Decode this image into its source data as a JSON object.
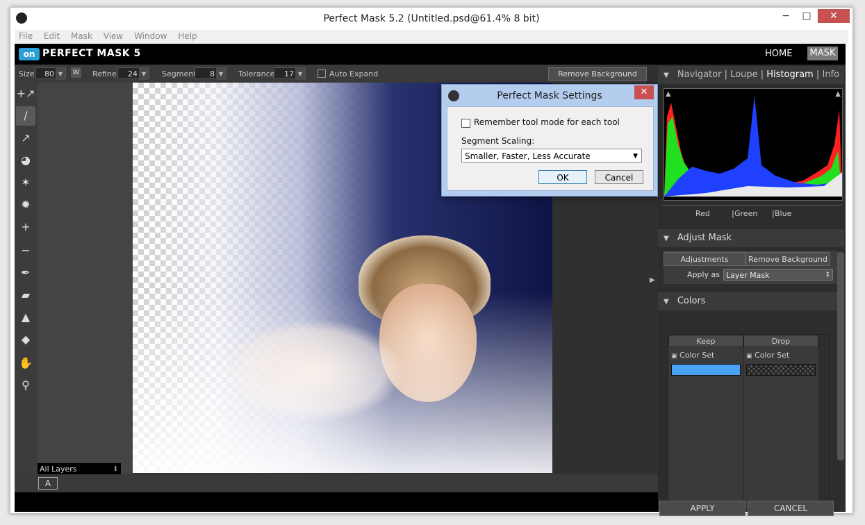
{
  "window": {
    "title": "Perfect Mask 5.2 (Untitled.psd@61.4% 8 bit)",
    "minimize": "−",
    "maximize": "□",
    "close": "✕"
  },
  "menu": [
    "File",
    "Edit",
    "Mask",
    "View",
    "Window",
    "Help"
  ],
  "app": {
    "logo": "on",
    "title": "PERFECT MASK 5",
    "home": "HOME",
    "mask": "MASK"
  },
  "tool_options": {
    "size_label": "Size",
    "size_value": "80",
    "w_label": "W",
    "refine_label": "Refine",
    "refine_value": "24",
    "segment_label": "Segment",
    "segment_value": "8",
    "tolerance_label": "Tolerance",
    "tolerance_value": "17",
    "auto_expand_label": "Auto Expand",
    "remove_background": "Remove Background"
  },
  "tools": [
    {
      "icon": "keep-brush-icon",
      "glyph": "+↗"
    },
    {
      "icon": "drop-brush-icon",
      "glyph": "∕"
    },
    {
      "icon": "eyedropper-icon",
      "glyph": "↗"
    },
    {
      "icon": "magic-brush-icon",
      "glyph": "◕"
    },
    {
      "icon": "spray-icon",
      "glyph": "✶"
    },
    {
      "icon": "splat-icon",
      "glyph": "✹"
    },
    {
      "icon": "add-dropper-icon",
      "glyph": "+"
    },
    {
      "icon": "subtract-dropper-icon",
      "glyph": "−"
    },
    {
      "icon": "pen-icon",
      "glyph": "✒"
    },
    {
      "icon": "eraser-icon",
      "glyph": "▰"
    },
    {
      "icon": "drop-icon",
      "glyph": "▲"
    },
    {
      "icon": "bucket-icon",
      "glyph": "◆"
    },
    {
      "icon": "hand-icon",
      "glyph": "✋"
    },
    {
      "icon": "zoom-icon",
      "glyph": "⚲"
    }
  ],
  "layers": {
    "selected": "All Layers"
  },
  "bottom": {
    "a_button": "A"
  },
  "right_panel": {
    "nav_tabs": [
      "Navigator",
      "Loupe",
      "Histogram",
      "Info"
    ],
    "nav_sep": "|",
    "active_tab": "Histogram",
    "histogram_channels": [
      "Red",
      "Green",
      "Blue"
    ],
    "adjust_mask": {
      "title": "Adjust Mask",
      "adjustments": "Adjustments",
      "remove_background": "Remove Background",
      "apply_as_label": "Apply as",
      "apply_as_value": "Layer Mask"
    },
    "colors": {
      "title": "Colors",
      "keep": "Keep",
      "drop": "Drop",
      "keep_set": "Color Set",
      "drop_set": "Color Set",
      "keep_color": "#4aa3f5"
    },
    "apply": "APPLY",
    "cancel": "CANCEL"
  },
  "dialog": {
    "title": "Perfect Mask Settings",
    "remember_label": "Remember tool mode for each tool",
    "segment_scaling_label": "Segment Scaling:",
    "segment_scaling_value": "Smaller, Faster, Less Accurate",
    "ok": "OK",
    "cancel": "Cancel"
  }
}
